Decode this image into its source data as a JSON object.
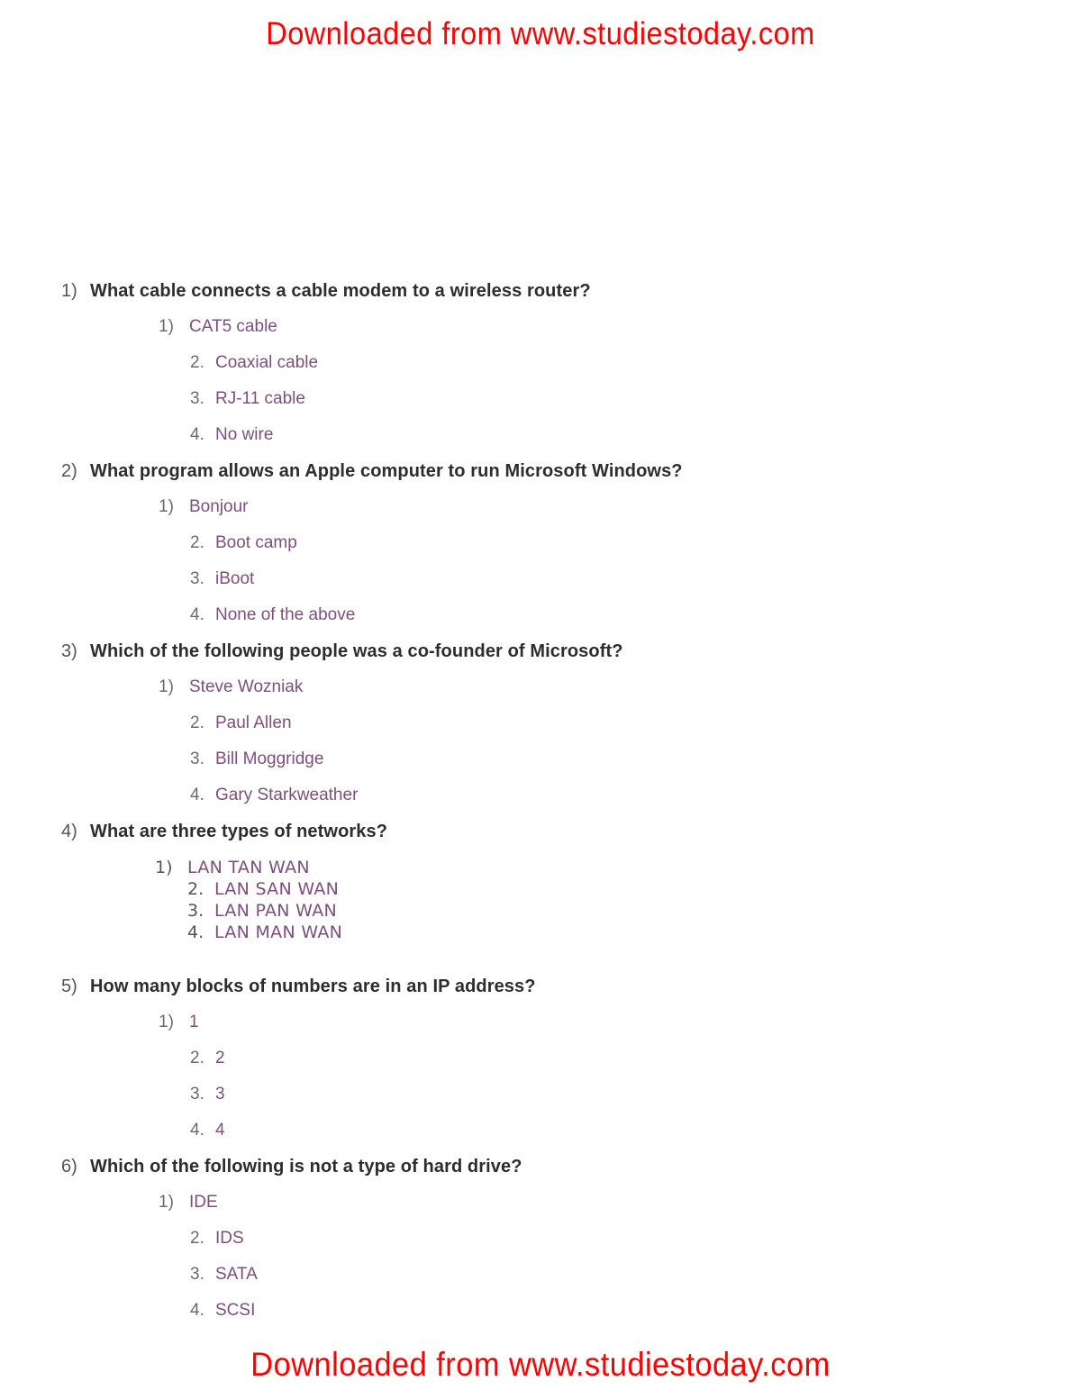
{
  "colors": {
    "watermark": "#ff0000",
    "question_text": "#2d2d2d",
    "question_number": "#555555",
    "option_marker": "#6b6b6b",
    "option_text": "#7d4f7d",
    "page_background": "#ffffff"
  },
  "watermark": {
    "top": "Downloaded  from  www.studiestoday.com",
    "bottom": "Downloaded  from  www.studiestoday.com"
  },
  "questions": [
    {
      "number": "1)",
      "text": "What cable connects a cable modem to a wireless router?",
      "options": [
        {
          "marker": "1)",
          "text": "CAT5 cable"
        },
        {
          "marker": "2.",
          "text": "Coaxial cable"
        },
        {
          "marker": "3.",
          "text": "RJ-11 cable"
        },
        {
          "marker": "4.",
          "text": "No wire"
        }
      ]
    },
    {
      "number": "2)",
      "text": "What program allows an Apple computer to run Microsoft Windows?",
      "options": [
        {
          "marker": "1)",
          "text": "Bonjour"
        },
        {
          "marker": "2.",
          "text": "Boot camp"
        },
        {
          "marker": "3.",
          "text": "iBoot"
        },
        {
          "marker": "4.",
          "text": "None of the above"
        }
      ]
    },
    {
      "number": "3)",
      "text": "Which of the following people was a co-founder of Microsoft?",
      "options": [
        {
          "marker": "1)",
          "text": "Steve Wozniak"
        },
        {
          "marker": "2.",
          "text": "Paul Allen"
        },
        {
          "marker": "3.",
          "text": "Bill Moggridge"
        },
        {
          "marker": "4.",
          "text": "Gary Starkweather"
        }
      ]
    },
    {
      "number": "4)",
      "text": "What are three types of networks?",
      "options": [
        {
          "marker": "1)",
          "text": "LAN TAN WAN"
        },
        {
          "marker": "2.",
          "text": "LAN SAN WAN"
        },
        {
          "marker": "3.",
          "text": "LAN PAN WAN"
        },
        {
          "marker": "4.",
          "text": "LAN MAN WAN"
        }
      ]
    },
    {
      "number": "5)",
      "text": "How many blocks of numbers are in an IP address?",
      "options": [
        {
          "marker": "1)",
          "text": "1"
        },
        {
          "marker": "2.",
          "text": "2"
        },
        {
          "marker": "3.",
          "text": "3"
        },
        {
          "marker": "4.",
          "text": "4"
        }
      ]
    },
    {
      "number": "6)",
      "text": "Which of the following is not a type of hard drive?",
      "options": [
        {
          "marker": "1)",
          "text": "IDE"
        },
        {
          "marker": "2.",
          "text": "IDS"
        },
        {
          "marker": "3.",
          "text": "SATA"
        },
        {
          "marker": "4.",
          "text": "SCSI"
        }
      ]
    }
  ]
}
